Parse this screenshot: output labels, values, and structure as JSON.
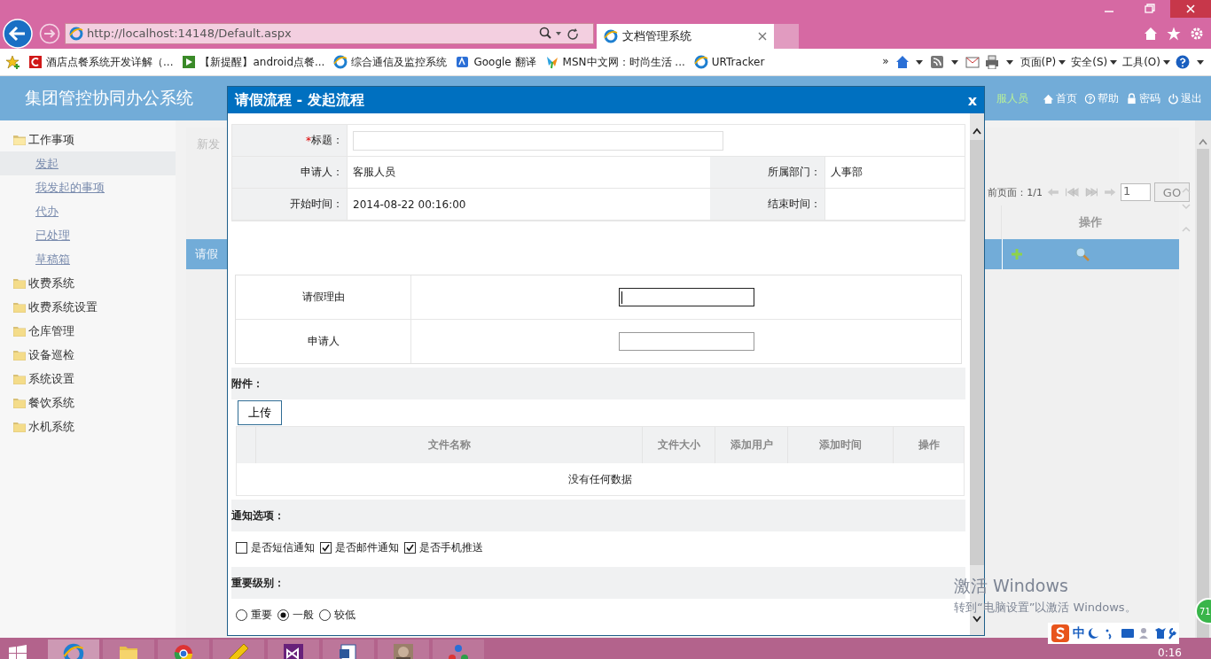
{
  "browser": {
    "url": "http://localhost:14148/Default.aspx",
    "tab": {
      "title": "文档管理系统"
    },
    "favorites": [
      {
        "kind": "red",
        "label": "酒店点餐系统开发详解（..."
      },
      {
        "kind": "green",
        "label": "【新提醒】android点餐..."
      },
      {
        "kind": "ie",
        "label": "综合通信及监控系统"
      },
      {
        "kind": "translate",
        "label": "Google 翻译"
      },
      {
        "kind": "msn",
        "label": "MSN中文网：时尚生活 ..."
      },
      {
        "kind": "ie",
        "label": "URTracker"
      }
    ],
    "overflow": "»",
    "commands": [
      "页面(P)",
      "安全(S)",
      "工具(O)"
    ]
  },
  "app": {
    "title": "集团管控协同办公系统",
    "user": "服人员",
    "nav": [
      {
        "kind": "home",
        "label": "首页"
      },
      {
        "kind": "help",
        "label": "帮助"
      },
      {
        "kind": "lock",
        "label": "密码"
      },
      {
        "kind": "power",
        "label": "退出"
      }
    ]
  },
  "sidebar": [
    {
      "label": "工作事项",
      "expanded": true,
      "children": [
        {
          "label": "发起",
          "selected": true
        },
        {
          "label": "我发起的事项",
          "selected": false
        },
        {
          "label": "代办",
          "selected": false
        },
        {
          "label": "已处理",
          "selected": false
        },
        {
          "label": "草稿箱",
          "selected": false
        }
      ]
    },
    {
      "label": "收费系统",
      "expanded": false
    },
    {
      "label": "收费系统设置",
      "expanded": false
    },
    {
      "label": "仓库管理",
      "expanded": false
    },
    {
      "label": "设备巡检",
      "expanded": false
    },
    {
      "label": "系统设置",
      "expanded": false
    },
    {
      "label": "餐饮系统",
      "expanded": false
    },
    {
      "label": "水机系统",
      "expanded": false
    }
  ],
  "background": {
    "breadcrumb": "新发",
    "pager": "前页面：1/1",
    "page": "1",
    "go": "GO",
    "column": "操作",
    "row": "请假"
  },
  "dialog": {
    "title": "请假流程 - 发起流程",
    "close": "x",
    "subject": {
      "required_mark": "*",
      "label": "标题："
    },
    "info": [
      {
        "label": "申请人：",
        "value": "客服人员",
        "label_2": "所属部门：",
        "value_2": "人事部"
      },
      {
        "label": "开始时间：",
        "value": "2014-08-22 00:16:00",
        "label_2": "结束时间："
      }
    ],
    "form_rows": [
      {
        "label": "请假理由",
        "focused": true
      },
      {
        "label": "申请人",
        "focused": false
      }
    ],
    "attachments": {
      "heading": "附件：",
      "upload": "上传",
      "columns": [
        "文件名称",
        "文件大小",
        "添加用户",
        "添加时间",
        "操作"
      ],
      "empty": "没有任何数据"
    },
    "notify": {
      "heading": "通知选项：",
      "options": [
        {
          "label": "是否短信通知",
          "checked": false
        },
        {
          "label": "是否邮件通知",
          "checked": true
        },
        {
          "label": "是否手机推送",
          "checked": true
        }
      ]
    },
    "priority": {
      "heading": "重要级别：",
      "options": [
        {
          "label": "重要",
          "selected": false
        },
        {
          "label": "一般",
          "selected": true
        },
        {
          "label": "较低",
          "selected": false
        }
      ]
    }
  },
  "activation": {
    "title": "激活 Windows",
    "hint": "转到“电脑设置”以激活 Windows。"
  },
  "taskbar": {
    "apps": [
      {
        "kind": "ie",
        "selected": true
      },
      {
        "kind": "folder",
        "selected": false
      },
      {
        "kind": "chrome",
        "selected": false
      },
      {
        "kind": "pencil",
        "selected": false
      },
      {
        "kind": "vs",
        "selected": false
      },
      {
        "kind": "word",
        "selected": false
      },
      {
        "kind": "photo",
        "selected": false
      },
      {
        "kind": "network",
        "selected": false
      }
    ],
    "ime": "中",
    "badge": "71",
    "clock": "0:16"
  }
}
